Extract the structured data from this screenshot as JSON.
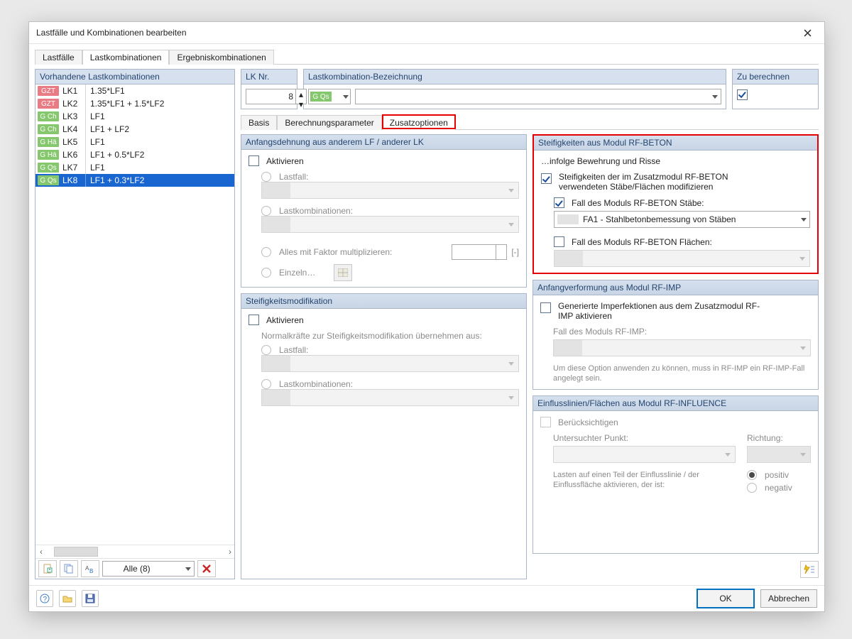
{
  "dialog_title": "Lastfälle und Kombinationen bearbeiten",
  "tabs": [
    "Lastfälle",
    "Lastkombinationen",
    "Ergebniskombinationen"
  ],
  "active_tab": 1,
  "left_panel": {
    "title": "Vorhandene Lastkombinationen",
    "rows": [
      {
        "tag": "GZT",
        "tagColor": "red",
        "lk": "LK1",
        "desc": "1.35*LF1"
      },
      {
        "tag": "GZT",
        "tagColor": "red",
        "lk": "LK2",
        "desc": "1.35*LF1 + 1.5*LF2"
      },
      {
        "tag": "G Ch",
        "tagColor": "green",
        "lk": "LK3",
        "desc": "LF1"
      },
      {
        "tag": "G Ch",
        "tagColor": "green",
        "lk": "LK4",
        "desc": "LF1 + LF2"
      },
      {
        "tag": "G Hä",
        "tagColor": "green",
        "lk": "LK5",
        "desc": "LF1"
      },
      {
        "tag": "G Hä",
        "tagColor": "green",
        "lk": "LK6",
        "desc": "LF1 + 0.5*LF2"
      },
      {
        "tag": "G Qs",
        "tagColor": "green",
        "lk": "LK7",
        "desc": "LF1"
      },
      {
        "tag": "G Qs",
        "tagColor": "green",
        "lk": "LK8",
        "desc": "LF1 + 0.3*LF2"
      }
    ],
    "selected_index": 7,
    "filter_label": "Alle (8)"
  },
  "lk_nr": {
    "title": "LK Nr.",
    "value": "8"
  },
  "lk_bez": {
    "title": "Lastkombination-Bezeichnung",
    "tag": "G Qs"
  },
  "zu_berechnen": {
    "title": "Zu berechnen",
    "checked": true
  },
  "subtabs": [
    "Basis",
    "Berechnungsparameter",
    "Zusatzoptionen"
  ],
  "active_subtab": 2,
  "col_left": {
    "anfang": {
      "title": "Anfangsdehnung aus anderem LF / anderer LK",
      "aktivieren": "Aktivieren",
      "lastfall": "Lastfall:",
      "lastkomb": "Lastkombinationen:",
      "faktor": "Alles mit Faktor multiplizieren:",
      "unit": "[-]",
      "einzeln": "Einzeln…"
    },
    "steifmod": {
      "title": "Steifigkeitsmodifikation",
      "aktivieren": "Aktivieren",
      "hint": "Normalkräfte zur Steifigkeitsmodifikation übernehmen aus:",
      "lastfall": "Lastfall:",
      "lastkomb": "Lastkombinationen:"
    }
  },
  "col_right": {
    "rfbeton": {
      "title": "Steifigkeiten aus Modul RF-BETON",
      "sub1": "…infolge Bewehrung und Risse",
      "opt1": "Steifigkeiten der im Zusatzmodul RF-BETON verwendeten Stäbe/Flächen modifizieren",
      "opt2": "Fall des Moduls RF-BETON Stäbe:",
      "sel": "FA1 - Stahlbetonbemessung von Stäben",
      "opt3": "Fall des Moduls RF-BETON Flächen:"
    },
    "rfimp": {
      "title": "Anfangverformung aus Modul RF-IMP",
      "opt": "Generierte Imperfektionen aus dem Zusatzmodul RF-IMP aktivieren",
      "lbl": "Fall des Moduls RF-IMP:",
      "hint": "Um diese Option anwenden zu können, muss in RF-IMP ein RF-IMP-Fall angelegt sein."
    },
    "rfinf": {
      "title": "Einflusslinien/Flächen aus Modul RF-INFLUENCE",
      "ber": "Berücksichtigen",
      "punkt": "Untersuchter Punkt:",
      "richtung": "Richtung:",
      "lasten": "Lasten auf einen Teil der Einflusslinie / der Einflussfläche aktivieren, der ist:",
      "pos": "positiv",
      "neg": "negativ"
    }
  },
  "footer": {
    "ok": "OK",
    "cancel": "Abbrechen"
  }
}
